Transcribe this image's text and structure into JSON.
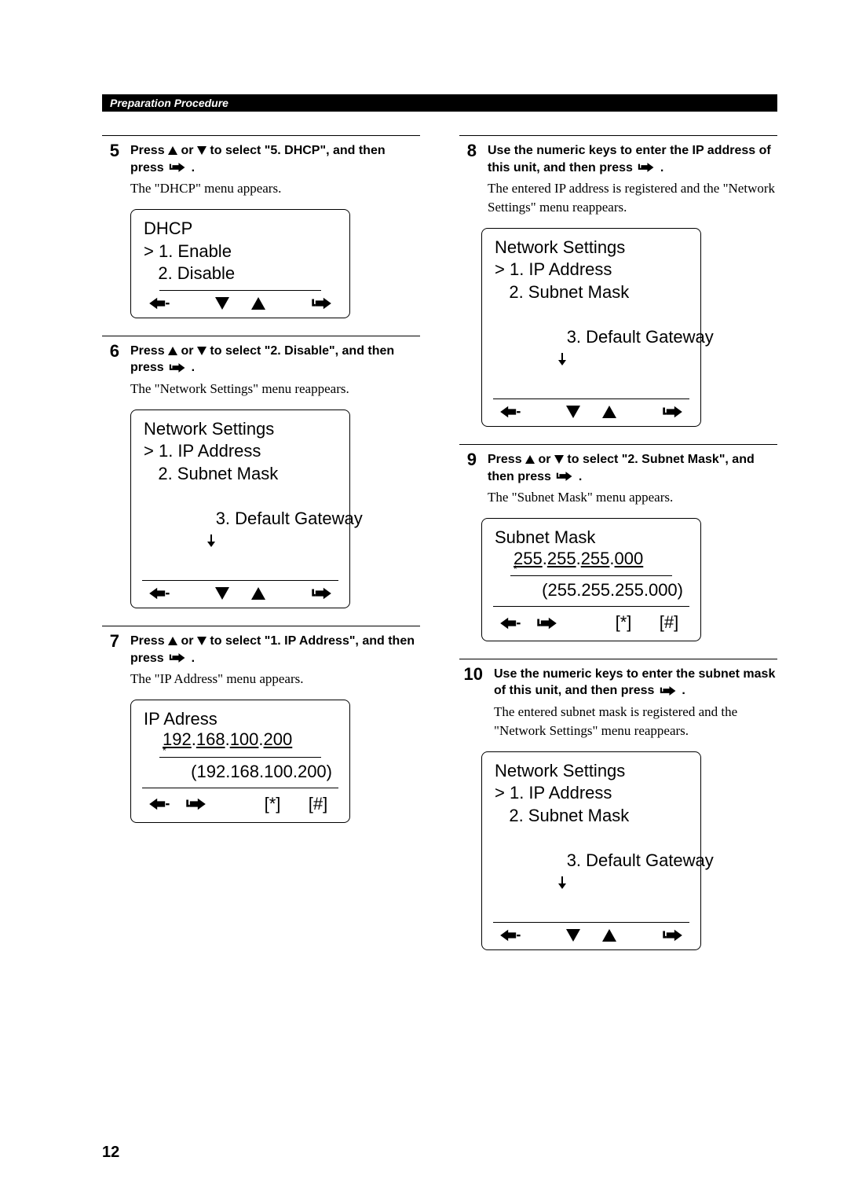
{
  "header": "Preparation Procedure",
  "page_number": "12",
  "steps": {
    "s5": {
      "num": "5",
      "instr_a": "Press ",
      "instr_b": " or ",
      "instr_c": " to select \"5. DHCP\", and then press ",
      "instr_d": ".",
      "result": "The \"DHCP\" menu appears.",
      "lcd": {
        "title": "DHCP",
        "l1": "> 1. Enable",
        "l2": "   2. Disable"
      }
    },
    "s6": {
      "num": "6",
      "instr_a": "Press ",
      "instr_b": " or ",
      "instr_c": " to select \"2. Disable\", and then press ",
      "instr_d": ".",
      "result": "The \"Network Settings\" menu reappears.",
      "lcd": {
        "title": "Network Settings",
        "l1": "> 1. IP Address",
        "l2": "   2. Subnet Mask",
        "l3": "   3. Default Gateway"
      }
    },
    "s7": {
      "num": "7",
      "instr_a": "Press ",
      "instr_b": " or ",
      "instr_c": " to select \"1. IP Address\", and then press ",
      "instr_d": ".",
      "result": "The \"IP Address\" menu appears.",
      "lcd": {
        "title": "IP Adress",
        "oct1": "192",
        "oct2": "168",
        "oct3": "100",
        "oct4": "200",
        "cursor": "*",
        "saved": "(192.168.100.200)",
        "sym_star": "[*]",
        "sym_hash": "[#]"
      }
    },
    "s8": {
      "num": "8",
      "instr_a": "Use the numeric keys to enter the IP address of this unit, and then press ",
      "instr_b": ".",
      "result": "The entered IP address is registered and the \"Network Settings\" menu reappears.",
      "lcd": {
        "title": "Network Settings",
        "l1": "> 1. IP Address",
        "l2": "   2. Subnet Mask",
        "l3": "   3. Default Gateway"
      }
    },
    "s9": {
      "num": "9",
      "instr_a": "Press ",
      "instr_b": " or ",
      "instr_c": " to select \"2. Subnet Mask\", and then press ",
      "instr_d": ".",
      "result": "The \"Subnet Mask\" menu appears.",
      "lcd": {
        "title": "Subnet Mask",
        "oct1": "255",
        "oct2": "255",
        "oct3": "255",
        "oct4": "000",
        "cursor": "*",
        "saved": "(255.255.255.000)",
        "sym_star": "[*]",
        "sym_hash": "[#]"
      }
    },
    "s10": {
      "num": "10",
      "instr_a": "Use the numeric keys to enter the subnet mask of this unit, and then press ",
      "instr_b": ".",
      "result": "The entered subnet mask is registered and the \"Network Settings\" menu reappears.",
      "lcd": {
        "title": "Network Settings",
        "l1": "> 1. IP Address",
        "l2": "   2. Subnet Mask",
        "l3": "   3. Default Gateway"
      }
    }
  }
}
